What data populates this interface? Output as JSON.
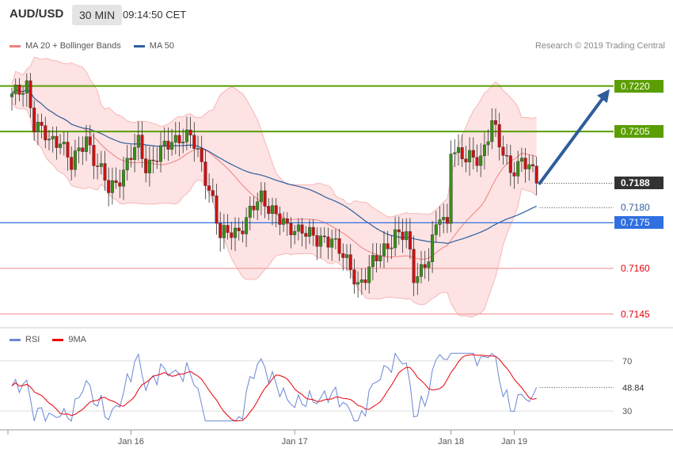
{
  "header": {
    "pair": "AUD/USD",
    "timeframe": "30 MIN",
    "time": "09:14:50 CET"
  },
  "legend": {
    "bb_label": "MA 20 + Bollinger Bands",
    "ma50_label": "MA 50",
    "rsi_label": "RSI",
    "ma9_label": "9MA"
  },
  "credit": "Research © 2019 Trading Central",
  "colors": {
    "bb": "#f08080",
    "bbFill": "#fde3e3",
    "ma50": "#2e5f9e",
    "green": "#5a9e00",
    "red": "#e8000b",
    "blueLevel": "#2f6fe0",
    "rsi": "#6a86d6",
    "ma9": "#e8000b",
    "arrow": "#2f5d9b"
  },
  "chart_data": {
    "type": "candlestick",
    "ylim": [
      7141,
      7229
    ],
    "scale": 10000,
    "x_ticks": [
      {
        "i": 32,
        "label": "Jan 16"
      },
      {
        "i": 76,
        "label": "Jan 17"
      },
      {
        "i": 118,
        "label": "Jan 18"
      },
      {
        "i": 135,
        "label": "Jan 19"
      }
    ],
    "levels": [
      {
        "value": "0.7220",
        "v": 7220,
        "kind": "green"
      },
      {
        "value": "0.7205",
        "v": 7205,
        "kind": "green"
      },
      {
        "value": "0.7175",
        "v": 7175,
        "kind": "blue"
      },
      {
        "value": "0.7160",
        "v": 7160,
        "kind": "red"
      },
      {
        "value": "0.7145",
        "v": 7145,
        "kind": "red"
      }
    ],
    "current": {
      "value": "0.7188",
      "v": 7188
    },
    "ma50_last": {
      "value": "0.7180",
      "v": 7180
    },
    "forecast": {
      "from_v": 7188,
      "to_v": 7220
    },
    "rsi": {
      "ylim": [
        20,
        80
      ],
      "ticks": [
        70,
        30
      ],
      "last": "48.84"
    }
  }
}
